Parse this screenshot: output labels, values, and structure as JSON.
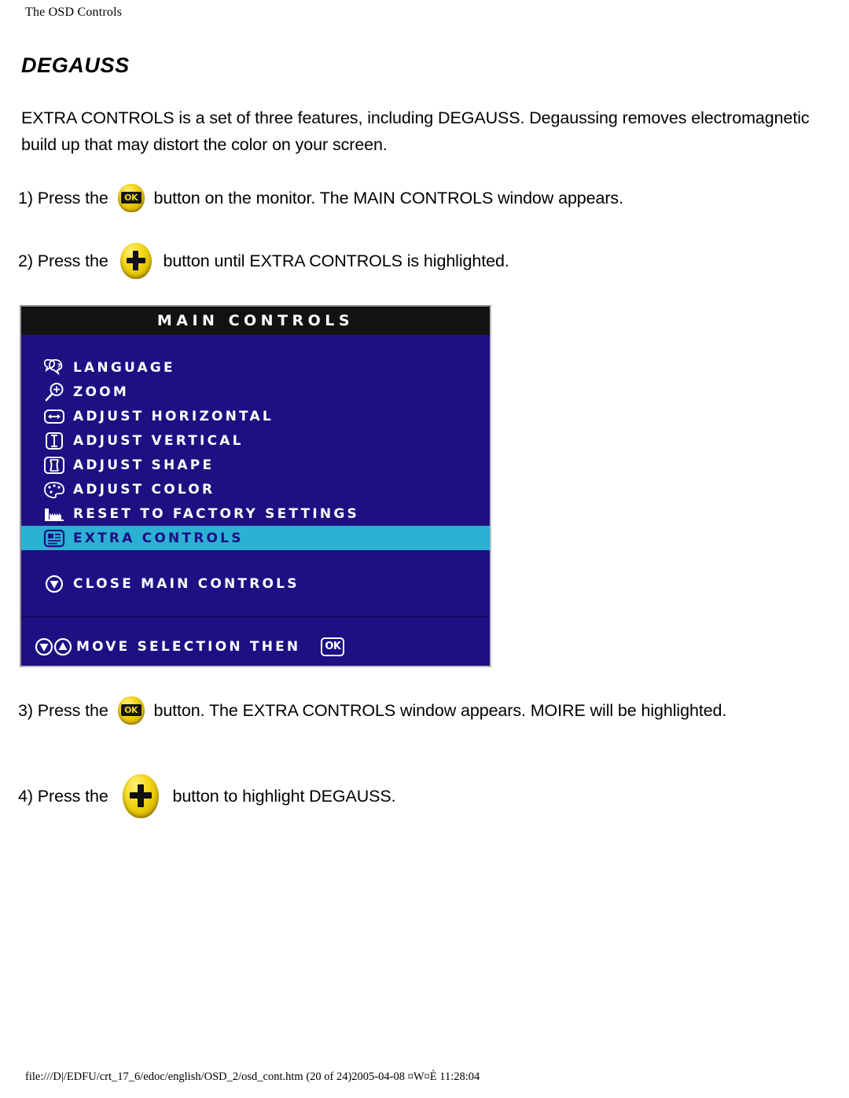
{
  "header": {
    "running_head": "The OSD Controls"
  },
  "title": "DEGAUSS",
  "intro": "EXTRA CONTROLS is a set of three features, including DEGAUSS. Degaussing removes electromagnetic build up that may distort the color on your screen.",
  "steps": {
    "step1_pre": "1) Press the",
    "step1_post": "button on the monitor. The MAIN CONTROLS window appears.",
    "step2_pre": "2) Press the",
    "step2_post": "button until EXTRA CONTROLS is highlighted.",
    "step3_pre": "3) Press the",
    "step3_post": "button. The EXTRA CONTROLS window appears. MOIRE will be highlighted.",
    "step4_pre": "4) Press the",
    "step4_post": "button to highlight DEGAUSS."
  },
  "buttons": {
    "ok_label": "OK",
    "plus_label": "+"
  },
  "osd": {
    "title": "MAIN CONTROLS",
    "items": [
      {
        "label": "LANGUAGE",
        "icon": "speech-bubbles-icon",
        "highlighted": false
      },
      {
        "label": "ZOOM",
        "icon": "magnifier-plus-icon",
        "highlighted": false
      },
      {
        "label": "ADJUST HORIZONTAL",
        "icon": "horizontal-arrows-icon",
        "highlighted": false
      },
      {
        "label": "ADJUST VERTICAL",
        "icon": "vertical-arrows-icon",
        "highlighted": false
      },
      {
        "label": "ADJUST SHAPE",
        "icon": "pincushion-shape-icon",
        "highlighted": false
      },
      {
        "label": "ADJUST COLOR",
        "icon": "color-palette-icon",
        "highlighted": false
      },
      {
        "label": "RESET TO FACTORY SETTINGS",
        "icon": "factory-reset-icon",
        "highlighted": false
      },
      {
        "label": "EXTRA CONTROLS",
        "icon": "document-list-icon",
        "highlighted": true
      }
    ],
    "close_item": {
      "label": "CLOSE MAIN CONTROLS",
      "icon": "down-arrow-circle-icon"
    },
    "footer_item": {
      "label": "MOVE SELECTION THEN",
      "icon": "up-down-arrow-circles-icon",
      "ok_glyph": "OK"
    },
    "colors": {
      "panel_background": "#1d1082",
      "titlebar_background": "#141210",
      "highlight_background": "#2cb0d4",
      "highlight_text": "#1d1082",
      "text": "#ffffff",
      "button_yellow": "#f2d416"
    }
  },
  "footer": {
    "path_line": "file:///D|/EDFU/crt_17_6/edoc/english/OSD_2/osd_cont.htm (20 of 24)2005-04-08 ¤W¤È 11:28:04"
  }
}
